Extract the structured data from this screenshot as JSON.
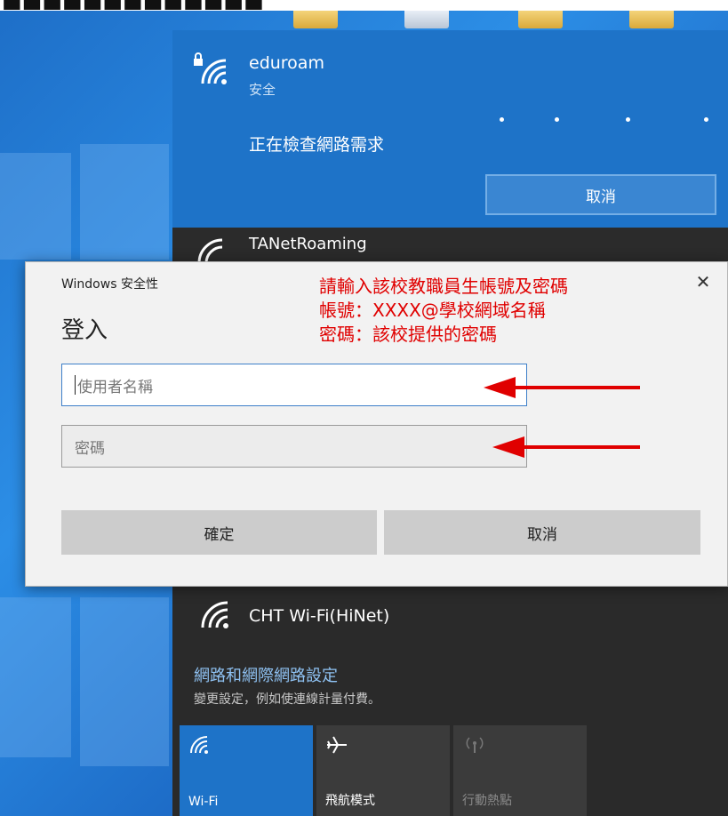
{
  "flyout": {
    "eduroam": {
      "name": "eduroam",
      "status": "安全",
      "checking_text": "正在檢查網路需求",
      "cancel_label": "取消"
    },
    "tanet": {
      "name": "TANetRoaming"
    },
    "cht": {
      "name": "CHT Wi-Fi(HiNet)"
    },
    "settings": {
      "title": "網路和網際網路設定",
      "subtitle": "變更設定，例如使連線計量付費。"
    },
    "quick_actions": [
      {
        "label": "Wi-Fi",
        "icon": "wifi-icon",
        "state": "on"
      },
      {
        "label": "飛航模式",
        "icon": "airplane-icon",
        "state": "off"
      },
      {
        "label": "行動熱點",
        "icon": "hotspot-icon",
        "state": "disabled"
      }
    ]
  },
  "dialog": {
    "caption": "Windows 安全性",
    "heading": "登入",
    "username_placeholder": "使用者名稱",
    "password_placeholder": "密碼",
    "ok_label": "確定",
    "cancel_label": "取消",
    "close_glyph": "✕"
  },
  "annotation": {
    "lines": [
      "請輸入該校教職員生帳號及密碼",
      "帳號：XXXX@學校網域名稱",
      "密碼：該校提供的密碼"
    ],
    "color": "#e00000"
  },
  "colors": {
    "accent": "#1e73c8",
    "flyout_bg": "#2a2a2a",
    "settings_link": "#8fc2f3"
  }
}
